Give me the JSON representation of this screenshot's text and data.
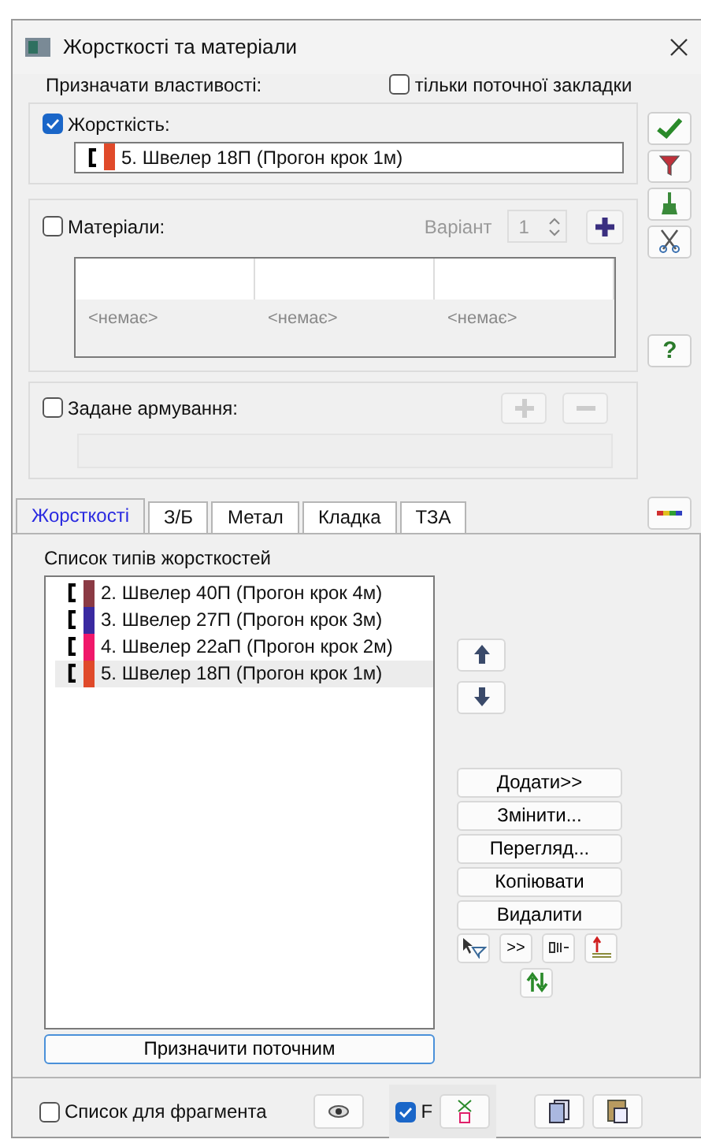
{
  "window": {
    "title": "Жорсткості та матеріали"
  },
  "assign": {
    "label": "Призначати властивості:",
    "only_current_tab": {
      "label": "тільки поточної закладки",
      "checked": false
    }
  },
  "stiffness": {
    "label": "Жорсткість:",
    "checked": true,
    "value": {
      "text": "5. Швелер 18П (Прогон крок 1м)",
      "color": "#e04a2a"
    }
  },
  "materials": {
    "label": "Матеріали:",
    "checked": false,
    "variant": {
      "label": "Варіант",
      "value": "1",
      "disabled": true
    },
    "columns": [
      "<немає>",
      "<немає>",
      "<немає>"
    ]
  },
  "reinforcement": {
    "label": "Задане армування:",
    "checked": false
  },
  "help_button": "?",
  "tabs": [
    {
      "label": "Жорсткості",
      "selected": true
    },
    {
      "label": "З/Б",
      "selected": false
    },
    {
      "label": "Метал",
      "selected": false
    },
    {
      "label": "Кладка",
      "selected": false
    },
    {
      "label": "ТЗА",
      "selected": false
    }
  ],
  "list": {
    "title": "Список типів жорсткостей",
    "items": [
      {
        "text": "2. Швелер 40П (Прогон крок 4м)",
        "color": "#8b3a44",
        "selected": false
      },
      {
        "text": "3. Швелер 27П (Прогон крок 3м)",
        "color": "#3a2aa0",
        "selected": false
      },
      {
        "text": "4. Швелер 22аП (Прогон крок 2м)",
        "color": "#f0186a",
        "selected": false
      },
      {
        "text": "5. Швелер 18П (Прогон крок 1м)",
        "color": "#e04a2a",
        "selected": true
      }
    ]
  },
  "buttons": [
    "Додати>>",
    "Змінити...",
    "Перегляд...",
    "Копіювати",
    "Видалити"
  ],
  "more_button": ">>",
  "assign_button": "Призначити поточним",
  "footer": {
    "fragment": {
      "label": "Список для фрагмента",
      "checked": false
    },
    "f": {
      "label": "F",
      "checked": true
    }
  }
}
